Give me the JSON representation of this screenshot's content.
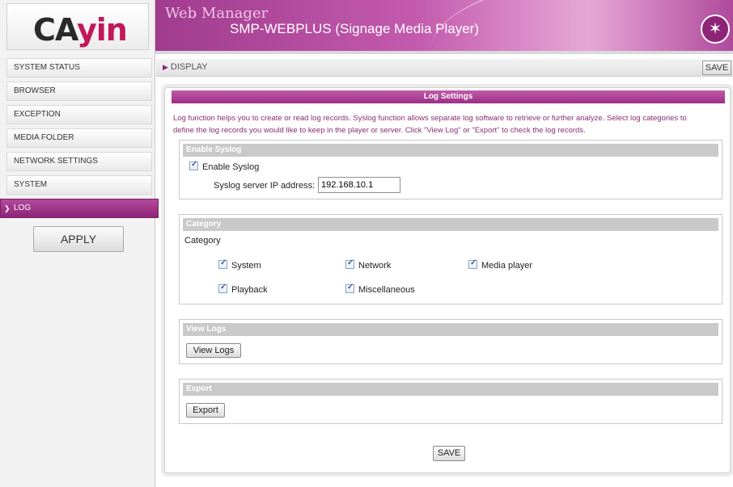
{
  "brand": {
    "logo_part1": "CA",
    "logo_part2": "yin",
    "accent": "#8e2478"
  },
  "header": {
    "app_title": "Web Manager",
    "product": "SMP-WEBPLUS (Signage Media Player)",
    "badge_icon": "star-wand-icon"
  },
  "sidebar": {
    "items": [
      {
        "label": "SYSTEM STATUS"
      },
      {
        "label": "BROWSER"
      },
      {
        "label": "EXCEPTION"
      },
      {
        "label": "MEDIA FOLDER"
      },
      {
        "label": "NETWORK SETTINGS"
      },
      {
        "label": "SYSTEM"
      },
      {
        "label": "LOG",
        "active": true
      }
    ],
    "apply_label": "APPLY"
  },
  "breadcrumb": {
    "label": "DISPLAY",
    "save_label": "SAVE"
  },
  "panel": {
    "title": "Log Settings",
    "description_line1": "Log function helps you to create or read log records. Syslog function allows separate log software to retrieve or further analyze. Select log categories to",
    "description_line2": "define the log records you would like to keep in the player or server. Click \"View Log\" or \"Export\" to check the log records."
  },
  "syslog": {
    "header": "Enable Syslog",
    "enable_label": "Enable Syslog",
    "enabled": true,
    "ip_label": "Syslog server IP address:",
    "ip_value": "192.168.10.1"
  },
  "category": {
    "header": "Category",
    "label": "Category",
    "items": [
      {
        "label": "System",
        "checked": true
      },
      {
        "label": "Network",
        "checked": true
      },
      {
        "label": "Media player",
        "checked": true
      },
      {
        "label": "Playback",
        "checked": true
      },
      {
        "label": "Miscellaneous",
        "checked": true
      }
    ]
  },
  "view_logs": {
    "header": "View Logs",
    "button_label": "View Logs"
  },
  "export": {
    "header": "Export",
    "button_label": "Export"
  },
  "footer": {
    "save_label": "SAVE"
  }
}
